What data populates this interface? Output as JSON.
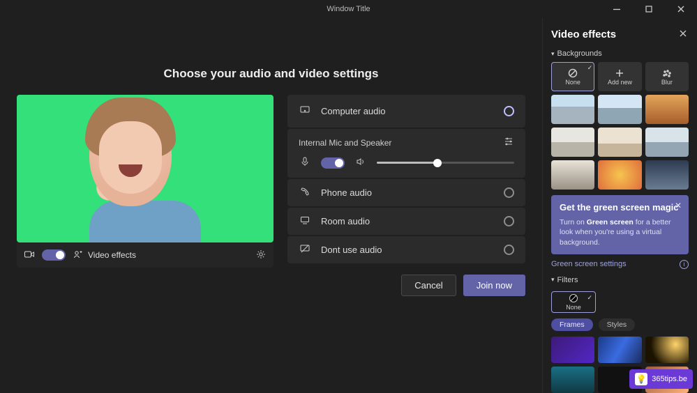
{
  "window": {
    "title": "Window Title"
  },
  "main": {
    "heading": "Choose your audio and video settings",
    "video_effects_label": "Video effects",
    "audio": {
      "computer": "Computer audio",
      "device_label": "Internal Mic and Speaker",
      "phone": "Phone audio",
      "room": "Room audio",
      "none": "Dont use audio"
    },
    "buttons": {
      "cancel": "Cancel",
      "join": "Join now"
    }
  },
  "panel": {
    "title": "Video effects",
    "backgrounds_label": "Backgrounds",
    "bg_none": "None",
    "bg_addnew": "Add new",
    "bg_blur": "Blur",
    "promo": {
      "title": "Get the green screen magic",
      "body_pre": "Turn on ",
      "body_bold": "Green screen",
      "body_post": " for a better look when you're using a virtual background."
    },
    "green_screen_link": "Green screen settings",
    "filters_label": "Filters",
    "filter_none": "None",
    "tabs": {
      "frames": "Frames",
      "styles": "Styles"
    }
  },
  "watermark": "365tips.be"
}
